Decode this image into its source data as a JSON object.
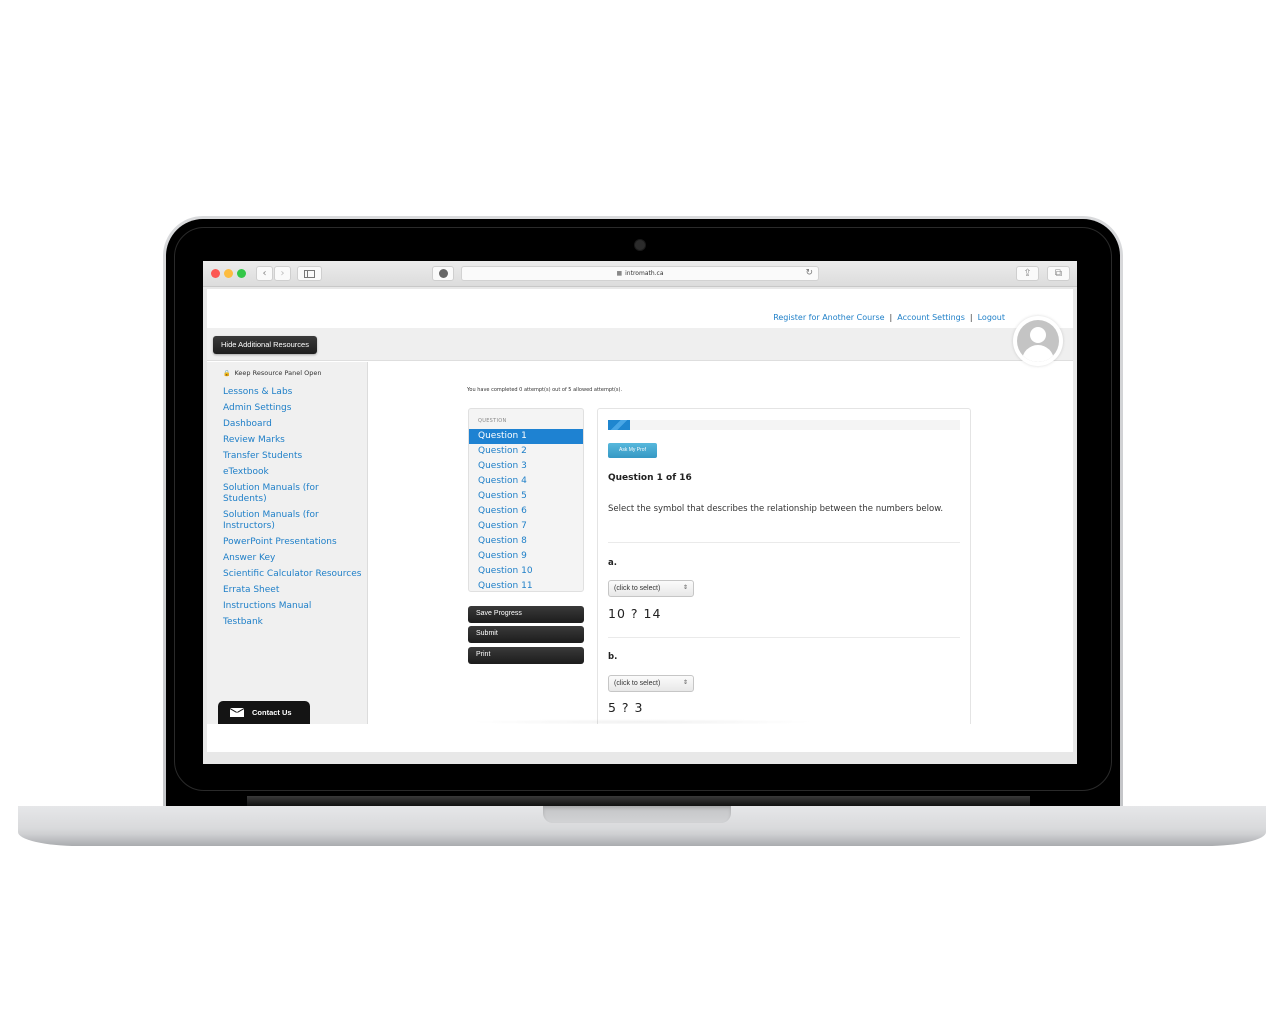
{
  "browser": {
    "url": "intromath.ca",
    "buttons": {
      "back": "‹",
      "forward": "›",
      "reload": "↻",
      "share": "⇪",
      "tabs": "⧉"
    },
    "icons": {
      "lock": "🔒"
    }
  },
  "header": {
    "links": [
      "Register for Another Course",
      "Account Settings",
      "Logout"
    ],
    "separator": "|",
    "hide_resources_label": "Hide Additional Resources"
  },
  "resource_panel": {
    "keep_open_label": "Keep Resource Panel Open",
    "items": [
      "Lessons & Labs",
      "Admin Settings",
      "Dashboard",
      "Review Marks",
      "Transfer Students",
      "eTextbook",
      "Solution Manuals (for Students)",
      "Solution Manuals (for Instructors)",
      "PowerPoint Presentations",
      "Answer Key",
      "Scientific Calculator Resources",
      "Errata Sheet",
      "Instructions Manual",
      "Testbank"
    ],
    "contact_label": "Contact Us"
  },
  "quiz": {
    "attempts_text": "You have completed 0 attempt(s) out of 5 allowed attempt(s).",
    "nav_heading": "QUESTION",
    "questions": [
      "Question 1",
      "Question 2",
      "Question 3",
      "Question 4",
      "Question 5",
      "Question 6",
      "Question 7",
      "Question 8",
      "Question 9",
      "Question 10",
      "Question 11"
    ],
    "active_question_index": 0,
    "actions": {
      "save": "Save Progress",
      "submit": "Submit",
      "print": "Print"
    },
    "progress_fraction": 0.0625,
    "ask_prof_label": "Ask My Prof",
    "title": "Question 1 of 16",
    "prompt": "Select the symbol that describes the relationship between the numbers below.",
    "parts": [
      {
        "label": "a.",
        "select_value": "(click to select)",
        "expression": "10 ? 14"
      },
      {
        "label": "b.",
        "select_value": "(click to select)",
        "expression": "5 ? 3"
      }
    ],
    "select_arrows": "⇕"
  }
}
